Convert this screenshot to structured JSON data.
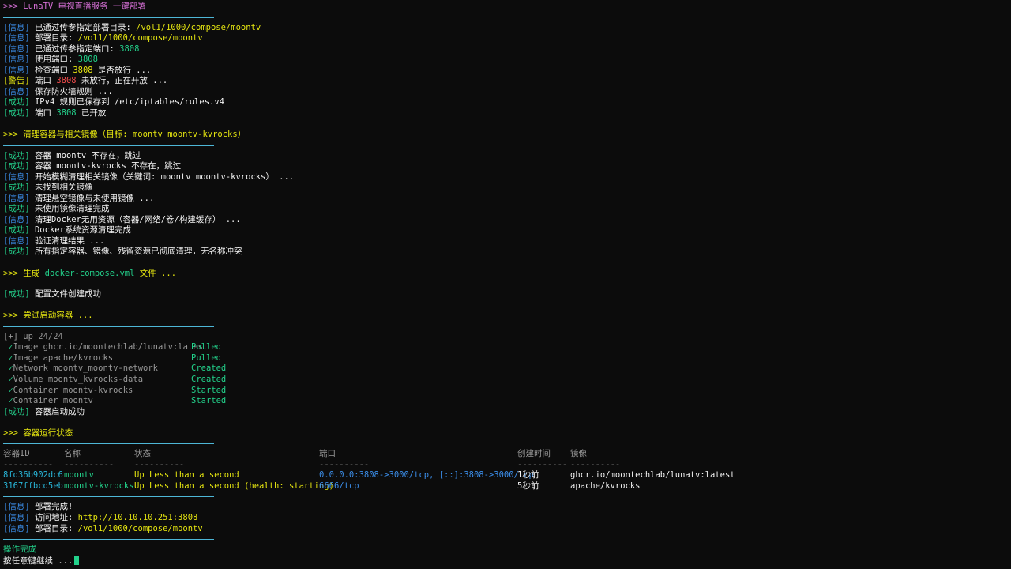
{
  "header": {
    "prompt": ">>> ",
    "title": "LunaTV 电视直播服务 一键部署"
  },
  "tags": {
    "info": "[信息]",
    "ok": "[成功]",
    "warn": "[警告]"
  },
  "deploy_lines": [
    {
      "tag": "info",
      "text": "已通过传参指定部署目录: ",
      "val": "/vol1/1000/compose/moontv",
      "valcls": "yellow"
    },
    {
      "tag": "info",
      "text": "部署目录: ",
      "val": "/vol1/1000/compose/moontv",
      "valcls": "yellow"
    },
    {
      "tag": "info",
      "text": "已通过传参指定端口: ",
      "val": "3808",
      "valcls": "green"
    },
    {
      "tag": "info",
      "text": "使用端口: ",
      "val": "3808",
      "valcls": "green"
    },
    {
      "tag": "info",
      "text": "检查端口 ",
      "val": "3808",
      "valcls": "yellow",
      "after": " 是否放行 ..."
    },
    {
      "tag": "warn",
      "text": "端口 ",
      "val": "3808",
      "valcls": "red",
      "after": " 未放行，正在开放 ..."
    },
    {
      "tag": "info",
      "text": "保存防火墙规则 ...",
      "val": "",
      "valcls": ""
    },
    {
      "tag": "ok",
      "text": "IPv4 规则已保存到 /etc/iptables/rules.v4",
      "val": "",
      "valcls": ""
    },
    {
      "tag": "ok",
      "text": "端口 ",
      "val": "3808",
      "valcls": "green",
      "after": " 已开放"
    }
  ],
  "section_cleanup": {
    "prompt": ">>> ",
    "title": "清理容器与相关镜像（目标: moontv moontv-kvrocks）"
  },
  "cleanup_lines": [
    {
      "tag": "ok",
      "text": "容器 moontv 不存在，跳过"
    },
    {
      "tag": "ok",
      "text": "容器 moontv-kvrocks 不存在，跳过"
    },
    {
      "tag": "info",
      "text": "开始模糊清理相关镜像（关键词: moontv moontv-kvrocks） ..."
    },
    {
      "tag": "ok",
      "text": "未找到相关镜像"
    },
    {
      "tag": "info",
      "text": "清理悬空镜像与未使用镜像 ..."
    },
    {
      "tag": "ok",
      "text": "未使用镜像清理完成"
    },
    {
      "tag": "info",
      "text": "清理Docker无用资源（容器/网络/卷/构建缓存） ..."
    },
    {
      "tag": "ok",
      "text": "Docker系统资源清理完成"
    },
    {
      "tag": "info",
      "text": "验证清理结果 ..."
    },
    {
      "tag": "ok",
      "text": "所有指定容器、镜像、残留资源已彻底清理，无名称冲突"
    }
  ],
  "section_compose": {
    "prompt": ">>> ",
    "title_pre": "生成 ",
    "title_file": "docker-compose.yml",
    "title_post": " 文件 ..."
  },
  "compose_ok": {
    "tag": "ok",
    "text": "配置文件创建成功"
  },
  "section_start": {
    "prompt": ">>> ",
    "title": "尝试启动容器 ..."
  },
  "compose_up": "[+] up 24/24",
  "compose_items": [
    {
      "check": "✓",
      "text": "Image ghcr.io/moontechlab/lunatv:latest",
      "status": "Pulled"
    },
    {
      "check": "✓",
      "text": "Image apache/kvrocks",
      "status": "Pulled"
    },
    {
      "check": "✓",
      "text": "Network moontv_moontv-network",
      "status": "Created"
    },
    {
      "check": "✓",
      "text": "Volume moontv_kvrocks-data",
      "status": "Created"
    },
    {
      "check": "✓",
      "text": "Container moontv-kvrocks",
      "status": "Started"
    },
    {
      "check": "✓",
      "text": "Container moontv",
      "status": "Started"
    }
  ],
  "start_ok": {
    "tag": "ok",
    "text": "容器启动成功"
  },
  "section_status": {
    "prompt": ">>> ",
    "title": "容器运行状态"
  },
  "ps_headers": [
    "容器ID",
    "名称",
    "状态",
    "端口",
    "创建时间",
    "镜像"
  ],
  "ps_dashes": [
    "----------",
    "----------",
    "----------",
    "----------",
    "----------",
    "----------"
  ],
  "ps_rows": [
    {
      "id": "8fd36b902dc6",
      "name": "moontv",
      "status": "Up Less than a second",
      "ports": "0.0.0.0:3808->3000/tcp, [::]:3808->3000/tcp",
      "created": "1秒前",
      "image": "ghcr.io/moontechlab/lunatv:latest"
    },
    {
      "id": "3167ffbcd5eb",
      "name": "moontv-kvrocks",
      "status": "Up Less than a second (health: starting)",
      "ports": "6666/tcp",
      "created": "5秒前",
      "image": "apache/kvrocks"
    }
  ],
  "final_lines": [
    {
      "tag": "info",
      "text": "部署完成!",
      "val": "",
      "valcls": ""
    },
    {
      "tag": "info",
      "text": "访问地址: ",
      "val": "http://10.10.10.251:3808",
      "valcls": "yellow"
    },
    {
      "tag": "info",
      "text": "部署目录: ",
      "val": "/vol1/1000/compose/moontv",
      "valcls": "yellow"
    }
  ],
  "done": "操作完成",
  "press_key": "按任意键继续 ...",
  "colors": {
    "background": "#0c0c0c",
    "info": "#3b8eea",
    "ok": "#23d18b",
    "warn": "#e5e510",
    "rule": "#4db6d6",
    "prompt": "#d670d6"
  }
}
